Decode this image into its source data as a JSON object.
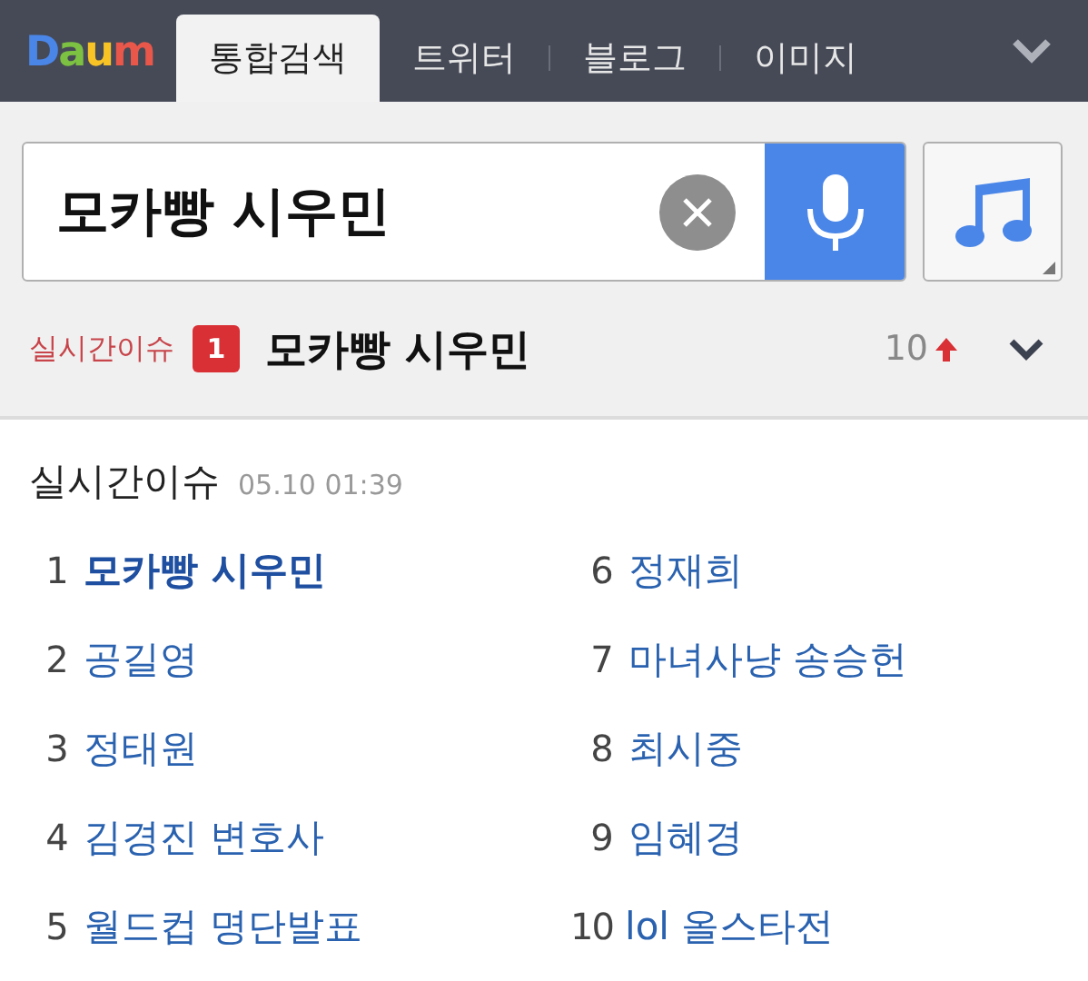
{
  "header": {
    "logo": "Daum",
    "tabs": [
      {
        "label": "통합검색",
        "selected": true
      },
      {
        "label": "트위터",
        "selected": false
      },
      {
        "label": "블로그",
        "selected": false
      },
      {
        "label": "이미지",
        "selected": false
      }
    ]
  },
  "search": {
    "value": "모카빵 시우민"
  },
  "ticker": {
    "label": "실시간이슈",
    "rank": "1",
    "keyword": "모카빵 시우민",
    "change": "10",
    "rising": true
  },
  "issues": {
    "title": "실시간이슈",
    "time": "05.10 01:39",
    "items": [
      {
        "rank": "1",
        "keyword": "모카빵 시우민",
        "highlighted": true
      },
      {
        "rank": "2",
        "keyword": "공길영",
        "highlighted": false
      },
      {
        "rank": "3",
        "keyword": "정태원",
        "highlighted": false
      },
      {
        "rank": "4",
        "keyword": "김경진 변호사",
        "highlighted": false
      },
      {
        "rank": "5",
        "keyword": "월드컵 명단발표",
        "highlighted": false
      },
      {
        "rank": "6",
        "keyword": "정재희",
        "highlighted": false
      },
      {
        "rank": "7",
        "keyword": "마녀사냥 송승헌",
        "highlighted": false
      },
      {
        "rank": "8",
        "keyword": "최시중",
        "highlighted": false
      },
      {
        "rank": "9",
        "keyword": "임혜경",
        "highlighted": false
      },
      {
        "rank": "10",
        "keyword": "lol 올스타전",
        "highlighted": false
      }
    ]
  }
}
